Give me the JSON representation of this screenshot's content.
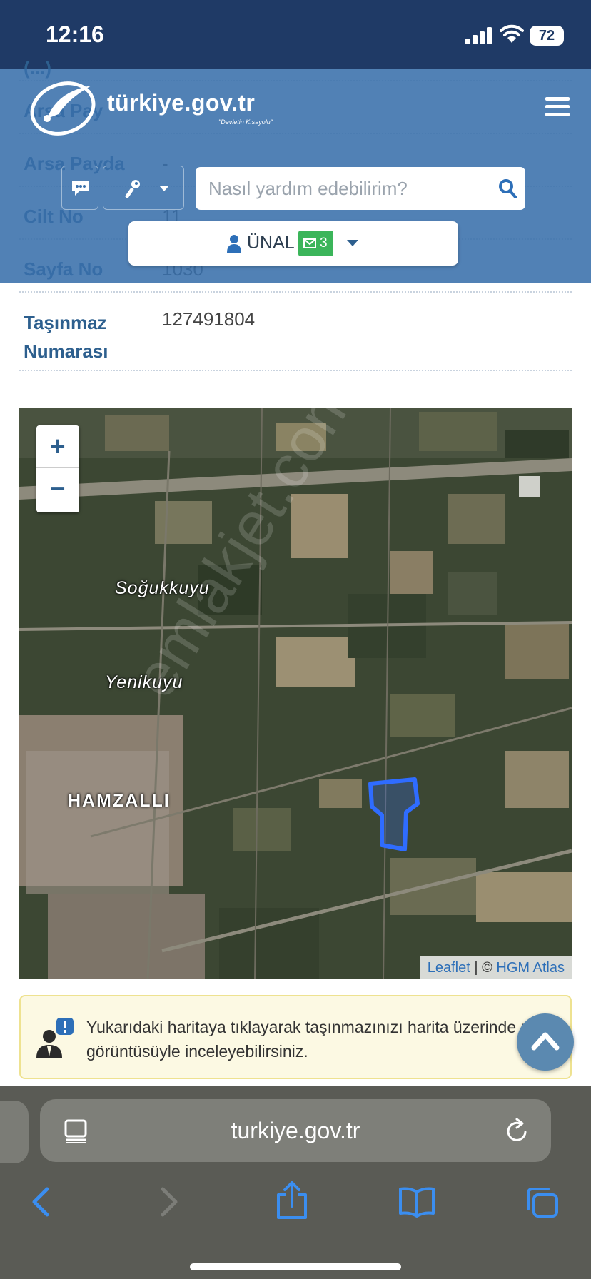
{
  "status_bar": {
    "time": "12:16",
    "battery": "72"
  },
  "site": {
    "brand": "türkiye.gov.tr",
    "tagline": "\"Devletin Kısayolu\""
  },
  "table_rows": [
    {
      "key": "(...)",
      "value": ""
    },
    {
      "key": "Arsa Pay",
      "value": ""
    },
    {
      "key": "Arsa Payda",
      "value": "-"
    },
    {
      "key": "Cilt No",
      "value": "11"
    },
    {
      "key": "Sayfa No",
      "value": "1030"
    },
    {
      "key": "Taşınmaz Numarası",
      "value": "127491804"
    }
  ],
  "search": {
    "placeholder": "Nasıl yardım edebilirim?"
  },
  "user": {
    "name": "ÜNAL",
    "message_count": "3"
  },
  "map": {
    "zoom_in": "+",
    "zoom_out": "−",
    "labels": [
      "Soğukkuyu",
      "Yenikuyu",
      "HAMZALLI"
    ],
    "watermark": "emlakjet.com",
    "attribution": {
      "leaflet": "Leaflet",
      "separator": " | © ",
      "provider": "HGM Atlas"
    },
    "parcel_color": "#2f6cff"
  },
  "info": {
    "text": "Yukarıdaki haritaya tıklayarak taşınmazınızı harita üzerinde uydu görüntüsüyle inceleyebilirsiniz."
  },
  "browser": {
    "url": "turkiye.gov.tr"
  }
}
